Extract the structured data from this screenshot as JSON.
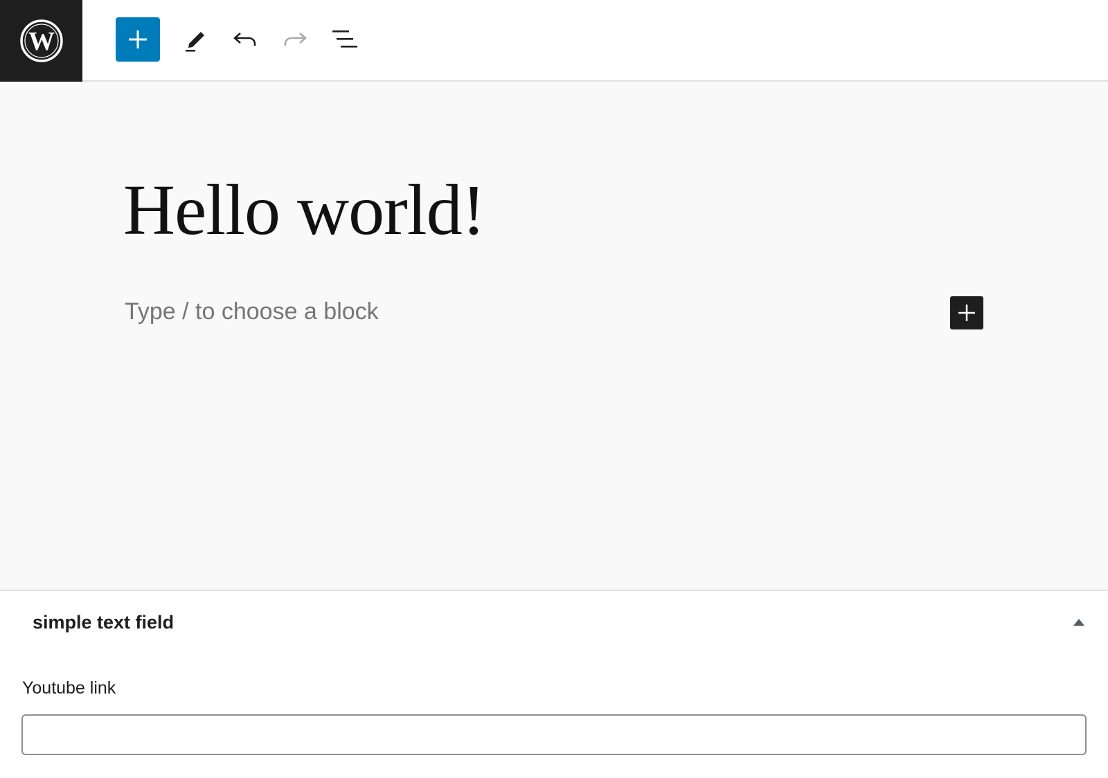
{
  "toolbar": {
    "logo_icon": "wordpress-logo-icon",
    "add_block_icon": "plus-icon",
    "tools_icon": "pencil-icon",
    "undo_icon": "undo-icon",
    "redo_icon": "redo-icon",
    "list_view_icon": "list-view-icon",
    "accent_color": "#007cba"
  },
  "editor": {
    "post_title": "Hello world!",
    "block_placeholder": "Type / to choose a block",
    "inserter_icon": "plus-icon"
  },
  "metabox": {
    "title": "simple text field",
    "toggle_icon": "caret-up-icon",
    "field_label": "Youtube link",
    "field_value": ""
  }
}
